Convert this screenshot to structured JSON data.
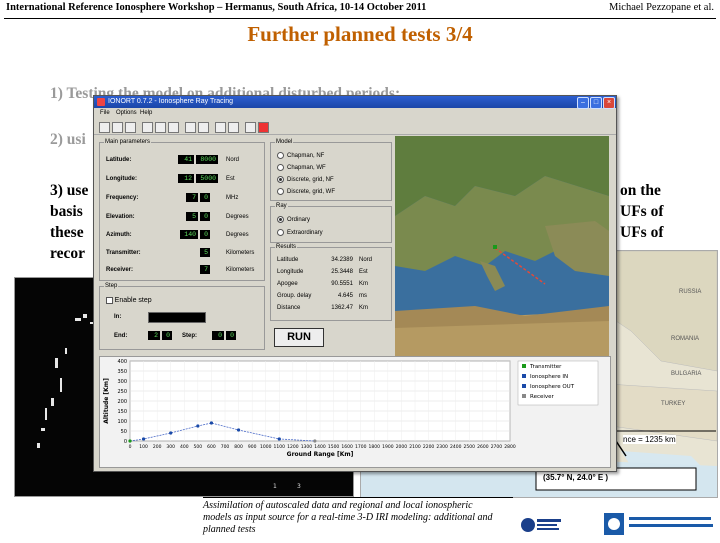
{
  "header": {
    "left": "International Reference Ionosphere Workshop – Hermanus, South Africa, 10-14 October 2011",
    "right": "Michael Pezzopane et al."
  },
  "slide_title": "Further planned tests 3/4",
  "items": {
    "item1": "1) Testing the model on additional disturbed periods;",
    "item2": "2) usi",
    "item3_lines": [
      "3) use",
      "basis",
      "these",
      "recor"
    ],
    "item3_right_lines": [
      "on the",
      "UFs of",
      "UFs of"
    ]
  },
  "window": {
    "title": "IONORT 0.7.2 - Ionosphere Ray Tracing",
    "menu": [
      "File",
      "Options",
      "Help"
    ],
    "main_params": {
      "label": "Main parameters",
      "fields": [
        {
          "name": "Latitude:",
          "val_a": "41",
          "val_b": "8000",
          "unit": "Nord"
        },
        {
          "name": "Longitude:",
          "val_a": "12",
          "val_b": "5000",
          "unit": "Est"
        },
        {
          "name": "Frequency:",
          "val_a": "7",
          "val_b": "0",
          "unit": "MHz"
        },
        {
          "name": "Elevation:",
          "val_a": "5",
          "val_b": "0",
          "unit": "Degrees"
        },
        {
          "name": "Azimuth:",
          "val_a": "140",
          "val_b": "0",
          "unit": "Degrees"
        },
        {
          "name": "Transmitter:",
          "val_a": "",
          "val_b": "5",
          "unit": "Kilometers"
        },
        {
          "name": "Receiver:",
          "val_a": "",
          "val_b": "7",
          "unit": "Kilometers"
        }
      ]
    },
    "model": {
      "label": "Model",
      "options": [
        "Chapman, NF",
        "Chapman, WF",
        "Discrete, grid, NF",
        "Discrete, grid, WF"
      ],
      "selected": 2
    },
    "ray": {
      "label": "Ray",
      "options": [
        "Ordinary",
        "Extraordinary"
      ],
      "selected": 0
    },
    "results": {
      "label": "Results",
      "rows": [
        {
          "name": "Latitude",
          "value": "34.2389",
          "unit": "Nord"
        },
        {
          "name": "Longitude",
          "value": "25.3448",
          "unit": "Est"
        },
        {
          "name": "Apogee",
          "value": "90.5551",
          "unit": "Km"
        },
        {
          "name": "Group. delay",
          "value": "4.645",
          "unit": "ms"
        },
        {
          "name": "Distance",
          "value": "1362.47",
          "unit": "Km"
        }
      ]
    },
    "step": {
      "label": "Step",
      "enable": "Enable step",
      "in_label": "In:",
      "end_label": "End:",
      "end_a": "2",
      "end_b": "0",
      "step_label": "Step:",
      "step_a": "0",
      "step_b": "0"
    },
    "run_label": "RUN"
  },
  "chart_data": {
    "type": "line",
    "xlabel": "Ground Range [Km]",
    "ylabel": "Altitude [Km]",
    "xlim": [
      0,
      2800
    ],
    "ylim": [
      0,
      400
    ],
    "x_ticks": [
      0,
      100,
      200,
      300,
      400,
      500,
      600,
      700,
      800,
      900,
      1000,
      1100,
      1200,
      1300,
      1400,
      1500,
      1600,
      1700,
      1800,
      1900,
      2000,
      2100,
      2200,
      2300,
      2400,
      2500,
      2600,
      2700,
      2800
    ],
    "y_ticks": [
      0,
      50,
      100,
      150,
      200,
      250,
      300,
      350,
      400
    ],
    "series": [
      {
        "name": "Transmitter",
        "x": [
          0
        ],
        "y": [
          0
        ],
        "color": "#1a9a1a"
      },
      {
        "name": "Ionosphere IN",
        "x": [
          100,
          300,
          500
        ],
        "y": [
          10,
          40,
          75
        ],
        "color": "#1a4aa8"
      },
      {
        "name": "Ionosphere OUT",
        "x": [
          600,
          800,
          1100
        ],
        "y": [
          90,
          55,
          10
        ],
        "color": "#1a4aa8"
      },
      {
        "name": "Receiver",
        "x": [
          1362
        ],
        "y": [
          0
        ],
        "color": "#888888"
      }
    ],
    "legend": [
      "Transmitter",
      "Ionosphere IN",
      "Ionosphere OUT",
      "Receiver"
    ],
    "legend_position": "top-right"
  },
  "map_bg": {
    "distance_text": "nce = 1235 km",
    "coord_text": "(35.7° N, 24.0° E )",
    "country_labels": [
      "RUSSIA",
      "ROMANIA",
      "BULGARIA",
      "TURKEY"
    ]
  },
  "caption": "Assimilation of autoscaled data and regional and local ionospheric models as input source for a real-time 3-D IRI modeling: additional and planned tests",
  "logos": {
    "left": "Science & Technology Facilities Council",
    "right_line1": "Istituto Nazionale di",
    "right_line2": "Geofisica e Vulcanologia"
  }
}
